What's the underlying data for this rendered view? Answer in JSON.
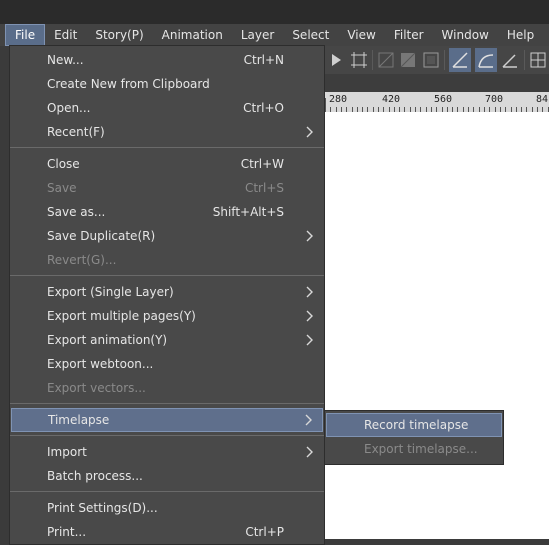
{
  "menubar": {
    "items": [
      "File",
      "Edit",
      "Story(P)",
      "Animation",
      "Layer",
      "Select",
      "View",
      "Filter",
      "Window",
      "Help"
    ]
  },
  "ruler": {
    "labels": [
      "280",
      "420",
      "560",
      "700",
      "84"
    ]
  },
  "file_menu": {
    "items": [
      {
        "label": "New...",
        "shortcut": "Ctrl+N",
        "submenu": false,
        "disabled": false
      },
      {
        "label": "Create New from Clipboard",
        "shortcut": "",
        "submenu": false,
        "disabled": false
      },
      {
        "label": "Open...",
        "shortcut": "Ctrl+O",
        "submenu": false,
        "disabled": false
      },
      {
        "label": "Recent(F)",
        "shortcut": "",
        "submenu": true,
        "disabled": false
      },
      {
        "label": "Close",
        "shortcut": "Ctrl+W",
        "submenu": false,
        "disabled": false
      },
      {
        "label": "Save",
        "shortcut": "Ctrl+S",
        "submenu": false,
        "disabled": true
      },
      {
        "label": "Save as...",
        "shortcut": "Shift+Alt+S",
        "submenu": false,
        "disabled": false
      },
      {
        "label": "Save Duplicate(R)",
        "shortcut": "",
        "submenu": true,
        "disabled": false
      },
      {
        "label": "Revert(G)...",
        "shortcut": "",
        "submenu": false,
        "disabled": true
      },
      {
        "label": "Export (Single Layer)",
        "shortcut": "",
        "submenu": true,
        "disabled": false
      },
      {
        "label": "Export multiple pages(Y)",
        "shortcut": "",
        "submenu": true,
        "disabled": false
      },
      {
        "label": "Export animation(Y)",
        "shortcut": "",
        "submenu": true,
        "disabled": false
      },
      {
        "label": "Export webtoon...",
        "shortcut": "",
        "submenu": false,
        "disabled": false
      },
      {
        "label": "Export vectors...",
        "shortcut": "",
        "submenu": false,
        "disabled": true
      },
      {
        "label": "Timelapse",
        "shortcut": "",
        "submenu": true,
        "disabled": false,
        "selected": true
      },
      {
        "label": "Import",
        "shortcut": "",
        "submenu": true,
        "disabled": false
      },
      {
        "label": "Batch process...",
        "shortcut": "",
        "submenu": false,
        "disabled": false
      },
      {
        "label": "Print Settings(D)...",
        "shortcut": "",
        "submenu": false,
        "disabled": false
      },
      {
        "label": "Print...",
        "shortcut": "Ctrl+P",
        "submenu": false,
        "disabled": false
      }
    ]
  },
  "timelapse_submenu": {
    "items": [
      {
        "label": "Record timelapse",
        "disabled": false,
        "selected": true
      },
      {
        "label": "Export timelapse...",
        "disabled": true
      }
    ]
  },
  "colors": {
    "menu_bg": "#494949",
    "highlight": "#5f6f8c",
    "disabled_text": "#8a8a8a"
  }
}
